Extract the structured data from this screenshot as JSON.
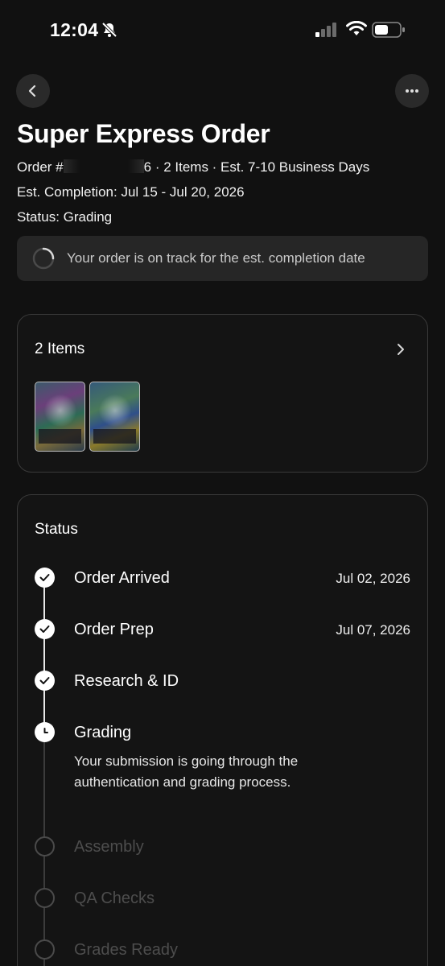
{
  "status_bar": {
    "time": "12:04"
  },
  "order": {
    "title": "Super Express Order",
    "order_prefix": "Order #",
    "order_suffix": "6 · 2 Items · Est. 7-10 Business Days",
    "est_label": "Est. Completion: ",
    "est_value": "Jul 15 - Jul 20, 2026",
    "status_label": "Status: ",
    "status_value": "Grading",
    "banner_text": "Your order is on track for the est. completion date"
  },
  "items_card": {
    "title": "2 Items",
    "thumbnails": [
      "card-1",
      "card-2"
    ]
  },
  "status_card": {
    "title": "Status",
    "steps": [
      {
        "label": "Order Arrived",
        "date": "Jul 02, 2026",
        "state": "done"
      },
      {
        "label": "Order Prep",
        "date": "Jul 07, 2026",
        "state": "done"
      },
      {
        "label": "Research & ID",
        "date": "",
        "state": "done"
      },
      {
        "label": "Grading",
        "date": "",
        "state": "current",
        "description": "Your submission is going through the authentication and grading process."
      },
      {
        "label": "Assembly",
        "date": "",
        "state": "pending"
      },
      {
        "label": "QA Checks",
        "date": "",
        "state": "pending"
      },
      {
        "label": "Grades Ready",
        "date": "",
        "state": "pending"
      }
    ]
  },
  "icons": {
    "back": "chevron-left-icon",
    "more": "more-horizontal-icon",
    "items_chevron": "chevron-right-icon",
    "done": "check-icon",
    "current": "clock-icon"
  },
  "colors": {
    "background": "#111111",
    "card": "#141414",
    "banner": "#262626",
    "pending": "#4d4d4d"
  }
}
